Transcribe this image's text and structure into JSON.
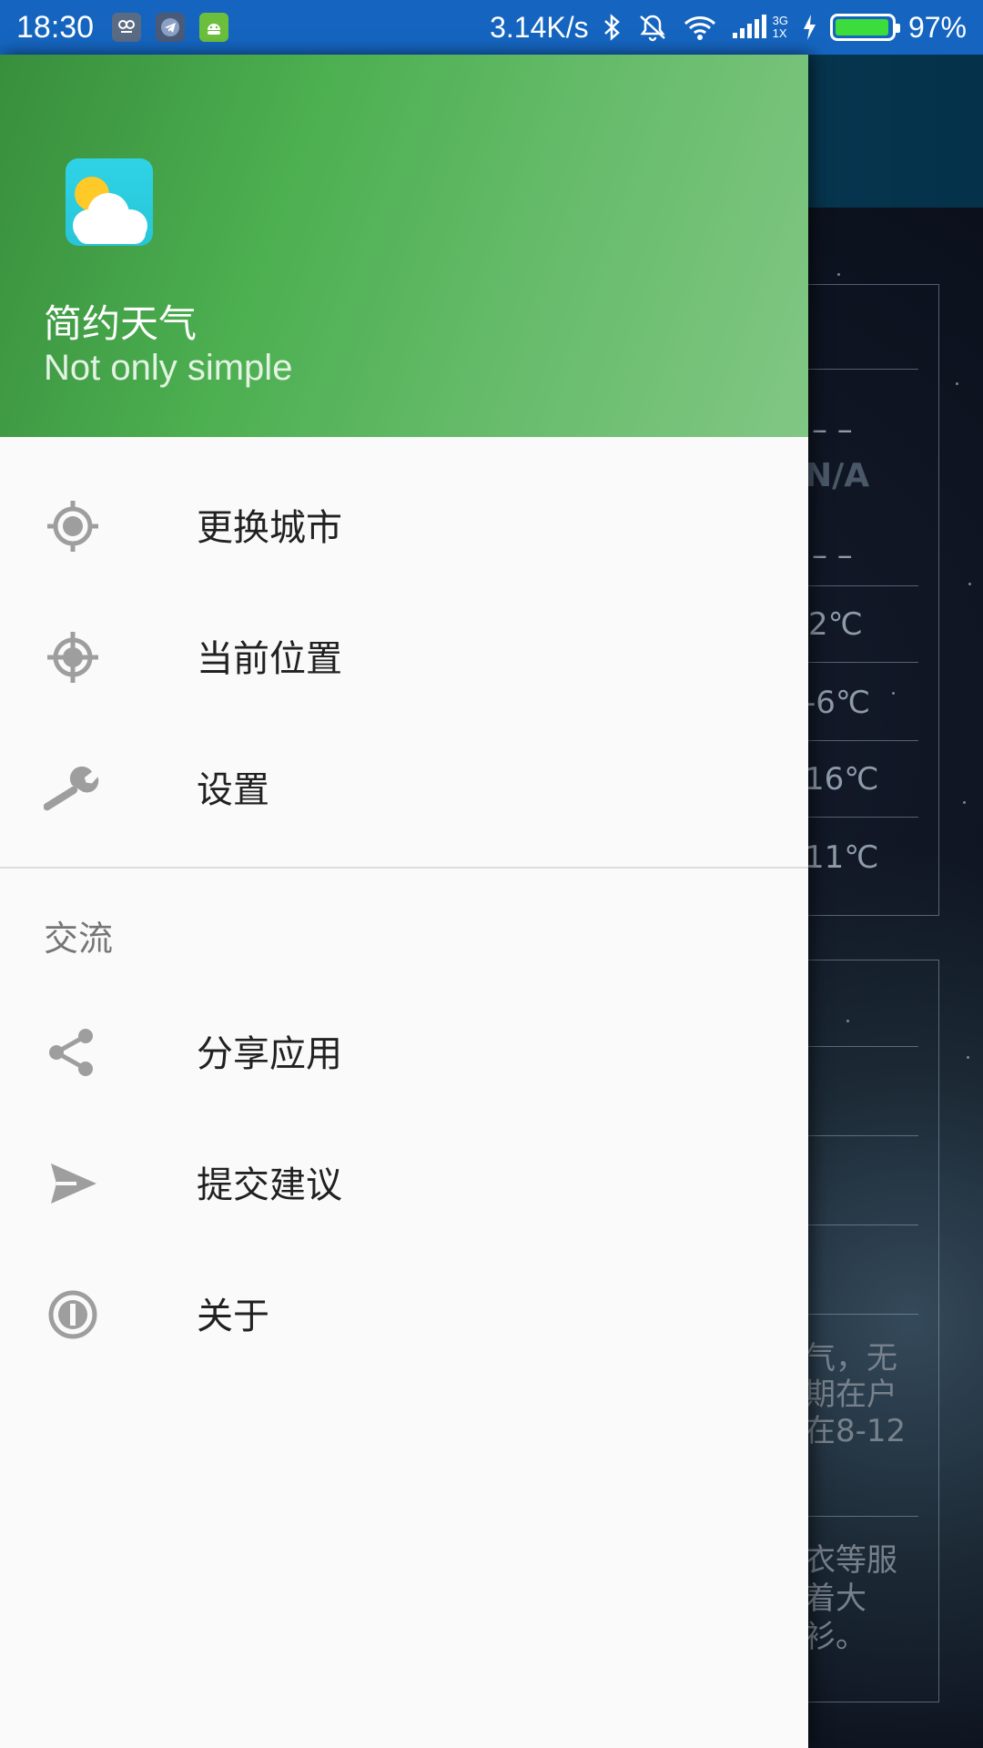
{
  "status_bar": {
    "time": "18:30",
    "net_speed": "3.14K/s",
    "signal_type_top": "3G",
    "signal_type_bottom": "1X",
    "battery_level": 0.97,
    "battery_text": "97%",
    "icons": [
      "app-notification-icon",
      "telegram-icon",
      "android-icon",
      "bluetooth-icon",
      "mute-icon",
      "wifi-icon",
      "signal-icon",
      "charging-icon",
      "battery-icon"
    ]
  },
  "drawer": {
    "header": {
      "app_name": "简约天气",
      "tagline": "Not only simple",
      "colors": {
        "start": "#388e3c",
        "end": "#81c784"
      }
    },
    "items": [
      {
        "label": "更换城市",
        "icon": "gps-target-icon"
      },
      {
        "label": "当前位置",
        "icon": "location-crosshair-icon"
      },
      {
        "label": "设置",
        "icon": "wrench-icon"
      }
    ],
    "section_title": "交流",
    "section_items": [
      {
        "label": "分享应用",
        "icon": "share-icon"
      },
      {
        "label": "提交建议",
        "icon": "send-icon"
      },
      {
        "label": "关于",
        "icon": "info-icon"
      }
    ]
  },
  "background": {
    "dash1": "– –",
    "na": "N/A",
    "dash2": "– –",
    "temps": [
      "2℃",
      "-6℃",
      "16℃",
      "11℃"
    ],
    "para1": [
      "气，无",
      "期在户",
      "在8-12"
    ],
    "para2": [
      "衣等服",
      "着大",
      "衫。"
    ]
  },
  "colors": {
    "status_bar": "#1565c0",
    "toolbar": "#0b4a66",
    "drawer_bg": "#fafafa",
    "icon_gray": "#9e9e9e"
  }
}
